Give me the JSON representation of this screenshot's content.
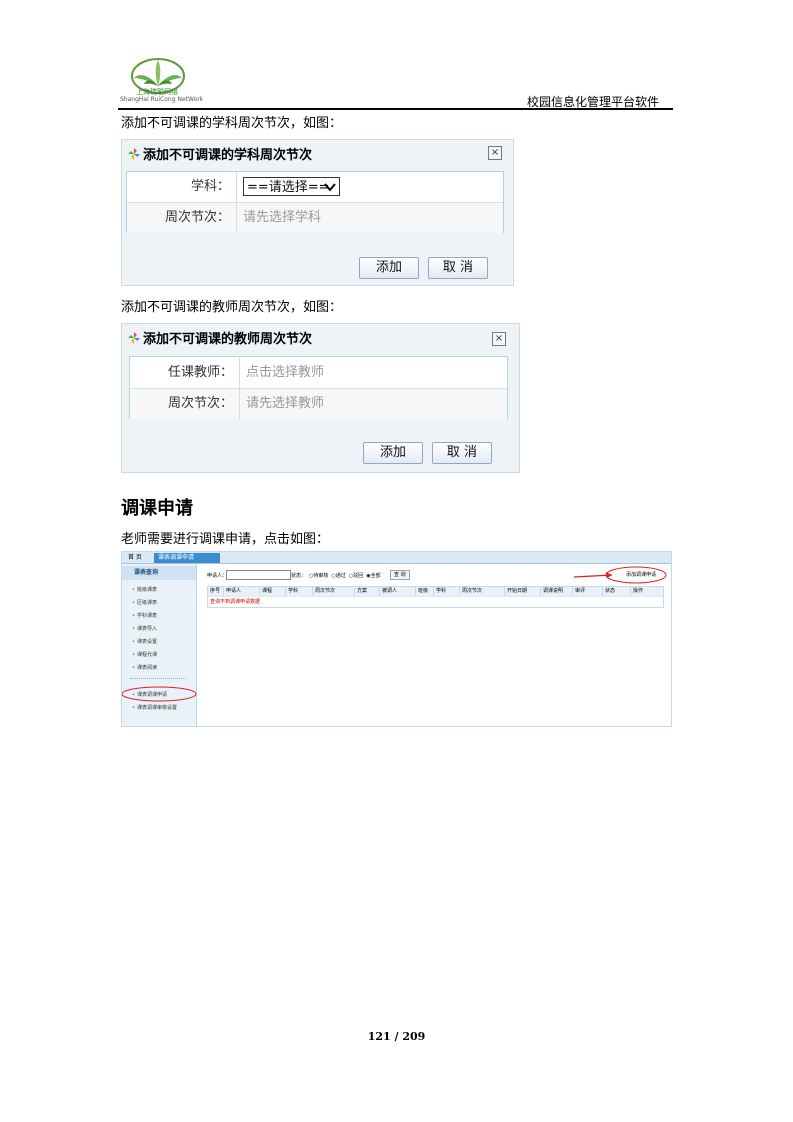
{
  "header": {
    "logo_cn": "上海瑞聪网络",
    "logo_en": "ShangHai RuiCong NetWork",
    "title": "校园信息化管理平台软件"
  },
  "para1": "添加不可调课的学科周次节次，如图：",
  "dialog1": {
    "title": "添加不可调课的学科周次节次",
    "close": "×",
    "rows": [
      {
        "label": "学科：",
        "value": "==请选择=="
      },
      {
        "label": "周次节次：",
        "value": "请先选择学科"
      }
    ],
    "add": "添加",
    "cancel": "取 消"
  },
  "para2": "添加不可调课的教师周次节次，如图：",
  "dialog2": {
    "title": "添加不可调课的教师周次节次",
    "close": "×",
    "rows": [
      {
        "label": "任课教师：",
        "value": "点击选择教师"
      },
      {
        "label": "周次节次：",
        "value": "请先选择教师"
      }
    ],
    "add": "添加",
    "cancel": "取 消"
  },
  "section_title": "调课申请",
  "para3": "老师需要进行调课申请，点击如图：",
  "screenshot": {
    "tab_home": "首 页",
    "tab_active": "课表调课申请",
    "side_head": "课表查询",
    "side_items": [
      "班级课表",
      "区级课表",
      "学科课表",
      "课表导入",
      "课表设置",
      "课程代课",
      "课表阅读"
    ],
    "side_items2": [
      "课表调课申请",
      "课表调课审核设置"
    ],
    "filter_label": "申请人：",
    "status_label": "状态：",
    "status_options": [
      "待审核",
      "通过",
      "驳回",
      "全部"
    ],
    "query": "查 询",
    "add_request": "添加调课申请",
    "columns": [
      "序号",
      "申请人",
      "课程",
      "学科",
      "周次节次",
      "方案",
      "被调人",
      "班级",
      "学科",
      "周次节次",
      "开始日期",
      "调课说明",
      "审评",
      "状态",
      "操作"
    ],
    "nodata": "查询不到调课申请数据"
  },
  "footer": {
    "page": "121 / 209"
  }
}
